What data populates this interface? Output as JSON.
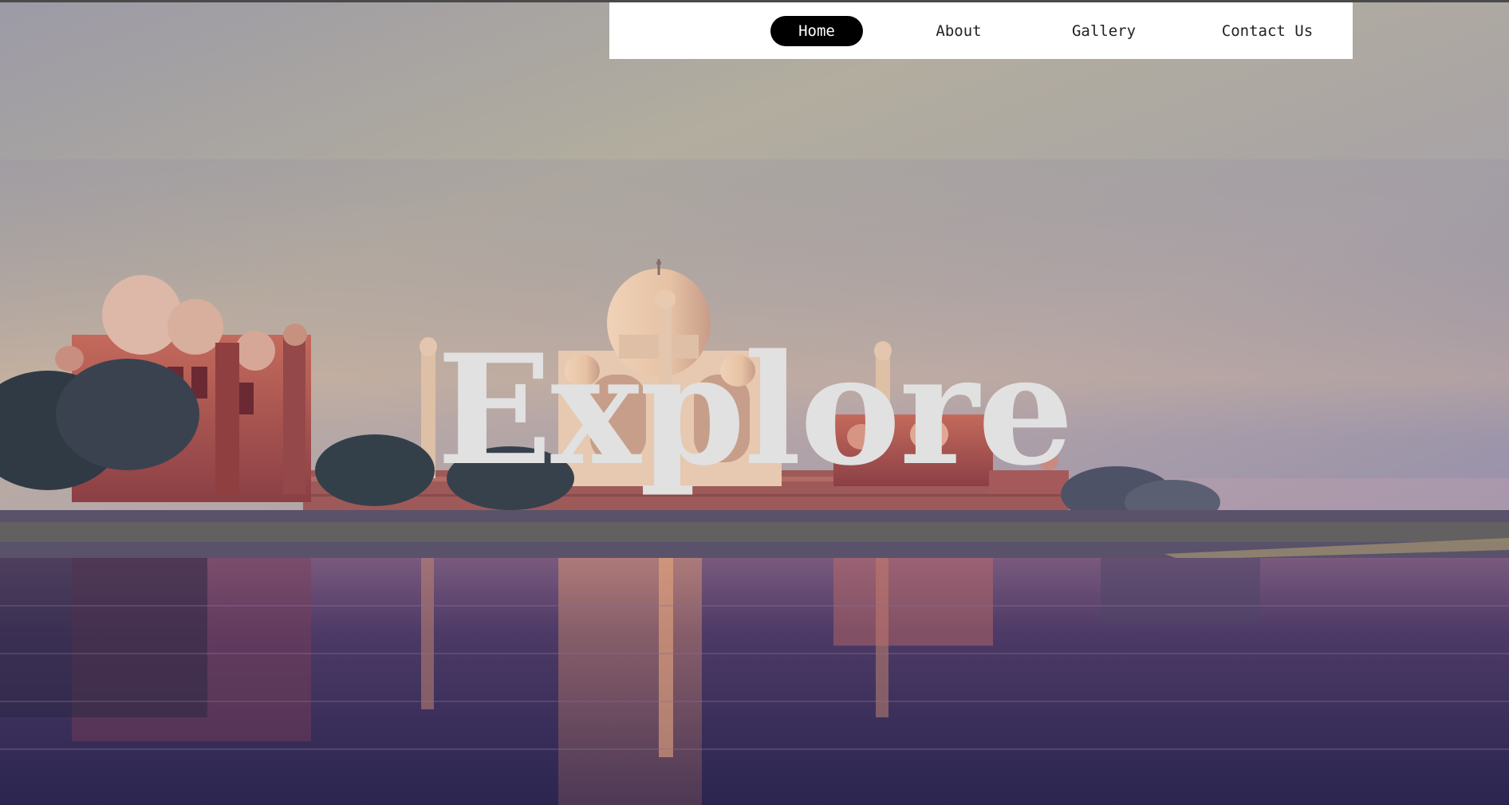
{
  "nav": {
    "items": [
      {
        "label": "Home",
        "active": true
      },
      {
        "label": "About",
        "active": false
      },
      {
        "label": "Gallery",
        "active": false
      },
      {
        "label": "Contact Us",
        "active": false
      }
    ]
  },
  "hero": {
    "title": "Explore",
    "background_image": "taj-mahal-river-sunrise"
  },
  "colors": {
    "nav_background": "#ffffff",
    "nav_active_background": "#000000",
    "nav_active_text": "#ffffff",
    "nav_text": "#222222",
    "hero_title": "#e1e1e1"
  }
}
